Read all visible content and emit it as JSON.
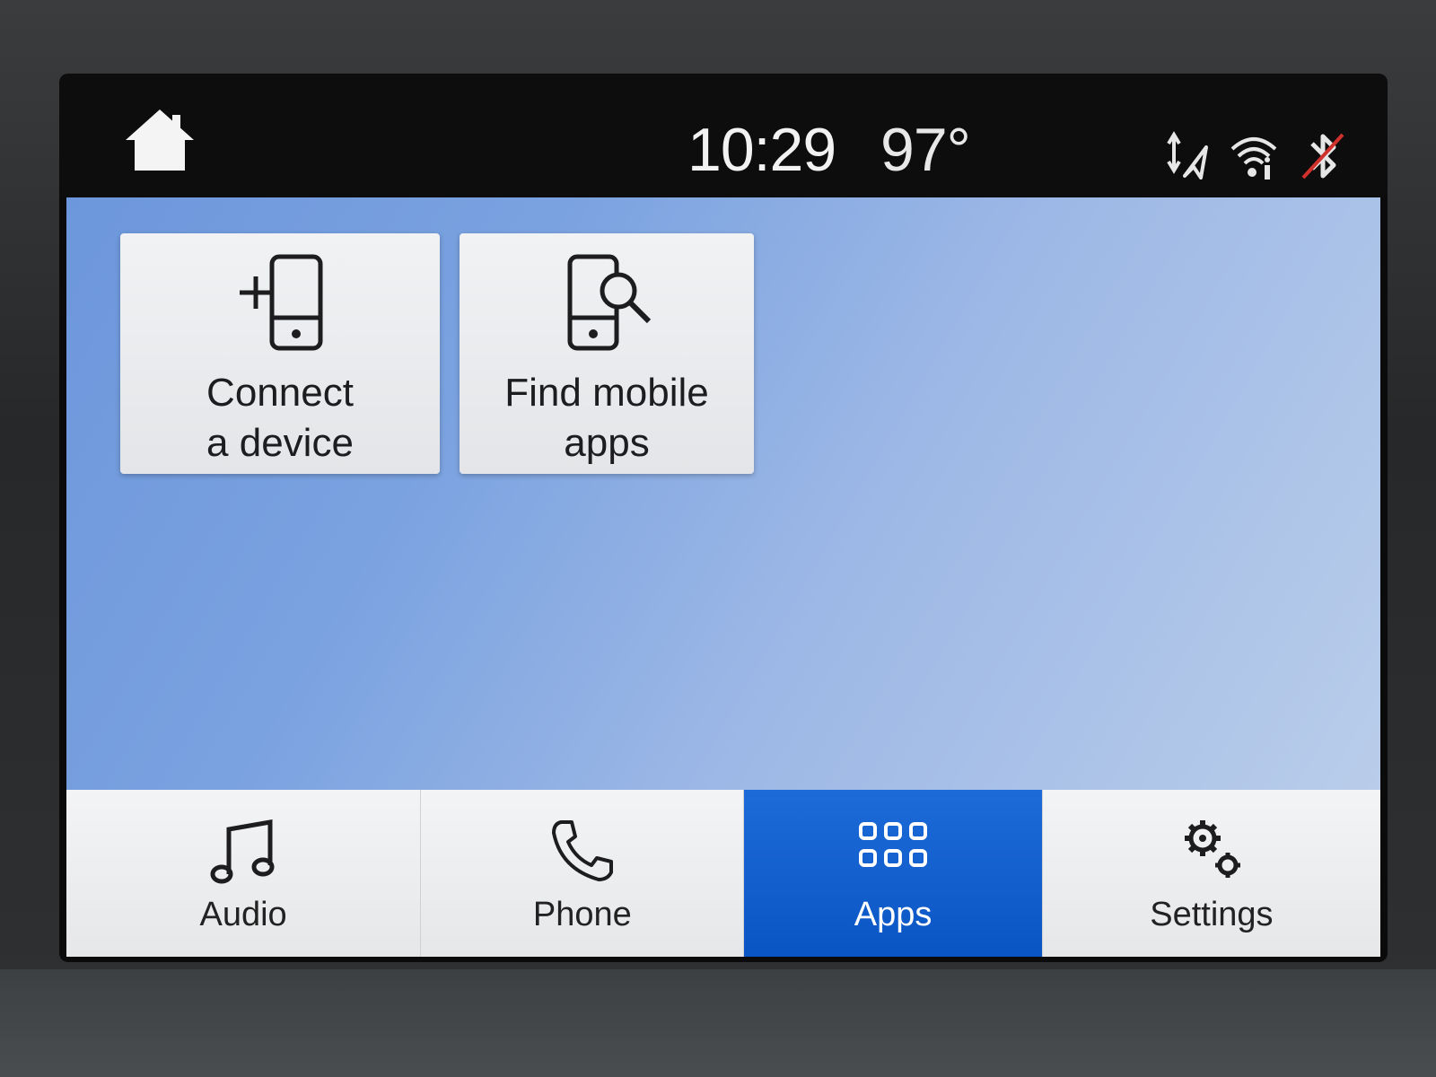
{
  "status_bar": {
    "time": "10:29",
    "temperature": "97°",
    "icons": [
      "home-icon",
      "navigation-icon",
      "wifi-info-icon",
      "bluetooth-disabled-icon"
    ]
  },
  "tiles": [
    {
      "id": "connect",
      "label": "Connect\na device",
      "icon": "add-phone-icon"
    },
    {
      "id": "find",
      "label": "Find mobile\napps",
      "icon": "phone-search-icon"
    }
  ],
  "nav": {
    "tabs": [
      {
        "id": "audio",
        "label": "Audio",
        "icon": "music-note-icon",
        "selected": false
      },
      {
        "id": "phone",
        "label": "Phone",
        "icon": "phone-handset-icon",
        "selected": false
      },
      {
        "id": "apps",
        "label": "Apps",
        "icon": "grid-icon",
        "selected": true
      },
      {
        "id": "settings",
        "label": "Settings",
        "icon": "gears-icon",
        "selected": false
      }
    ]
  },
  "colors": {
    "accent": "#0a55c4",
    "background_blue": "#7aa2e0",
    "status_bar": "#0d0d0e",
    "bluetooth_strike": "#d0312d"
  }
}
